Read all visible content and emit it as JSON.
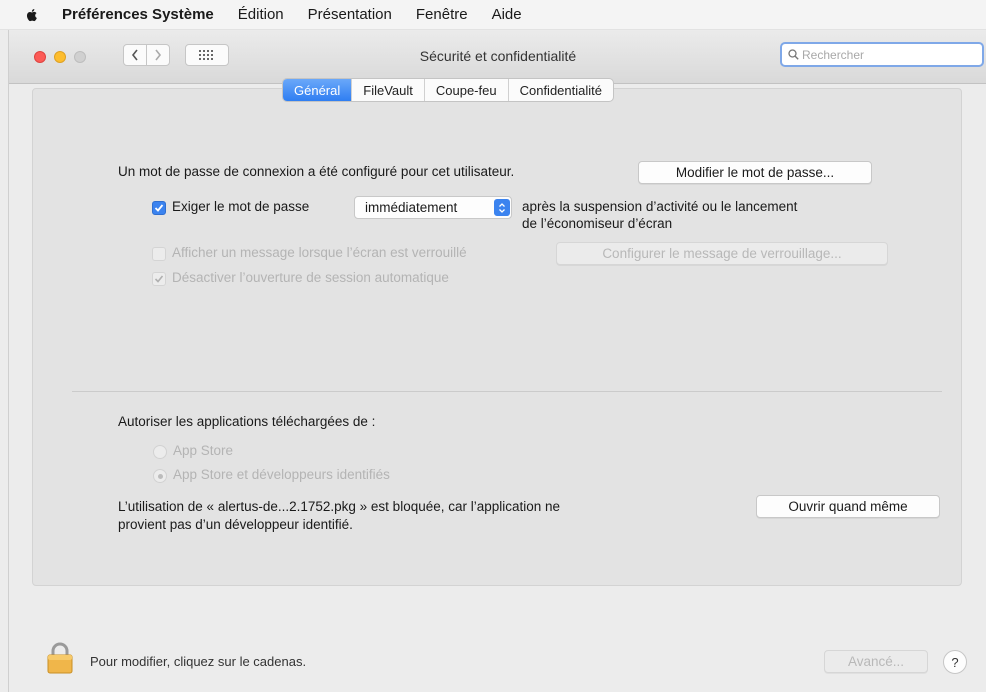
{
  "menubar": {
    "items": [
      "Préférences Système",
      "Édition",
      "Présentation",
      "Fenêtre",
      "Aide"
    ]
  },
  "window": {
    "title": "Sécurité et confidentialité",
    "search_placeholder": "Rechercher"
  },
  "tabs": [
    {
      "label": "Général",
      "active": true
    },
    {
      "label": "FileVault",
      "active": false
    },
    {
      "label": "Coupe-feu",
      "active": false
    },
    {
      "label": "Confidentialité",
      "active": false
    }
  ],
  "general": {
    "password_set_text": "Un mot de passe de connexion a été configuré pour cet utilisateur.",
    "change_password_button": "Modifier le mot de passe...",
    "require_password_label": "Exiger le mot de passe",
    "require_password_checked": true,
    "require_password_delay": "immédiatement",
    "after_sleep_line1": "après la suspension d’activité ou le lancement",
    "after_sleep_line2": "de l’économiseur d’écran",
    "show_message_label": "Afficher un message lorsque l’écran est verrouillé",
    "show_message_checked": false,
    "set_lock_message_button": "Configurer le message de verrouillage...",
    "disable_autologin_label": "Désactiver l’ouverture de session automatique",
    "disable_autologin_checked": true
  },
  "downloads": {
    "heading": "Autoriser les applications téléchargées de :",
    "options": [
      {
        "label": "App Store",
        "selected": false
      },
      {
        "label": "App Store et développeurs identifiés",
        "selected": true
      }
    ],
    "blocked_line1": "L’utilisation de « alertus-de...2.1752.pkg » est bloquée, car l’application ne",
    "blocked_line2": "provient pas d’un développeur identifié.",
    "open_anyway_button": "Ouvrir quand même"
  },
  "footer": {
    "lock_text": "Pour modifier, cliquez sur le cadenas.",
    "advanced_button": "Avancé...",
    "help_button": "?"
  },
  "colors": {
    "accent": "#3b83ef",
    "close": "#fc5b57",
    "minimize": "#fdbd2e",
    "lock_gold": "#f0b64a"
  }
}
